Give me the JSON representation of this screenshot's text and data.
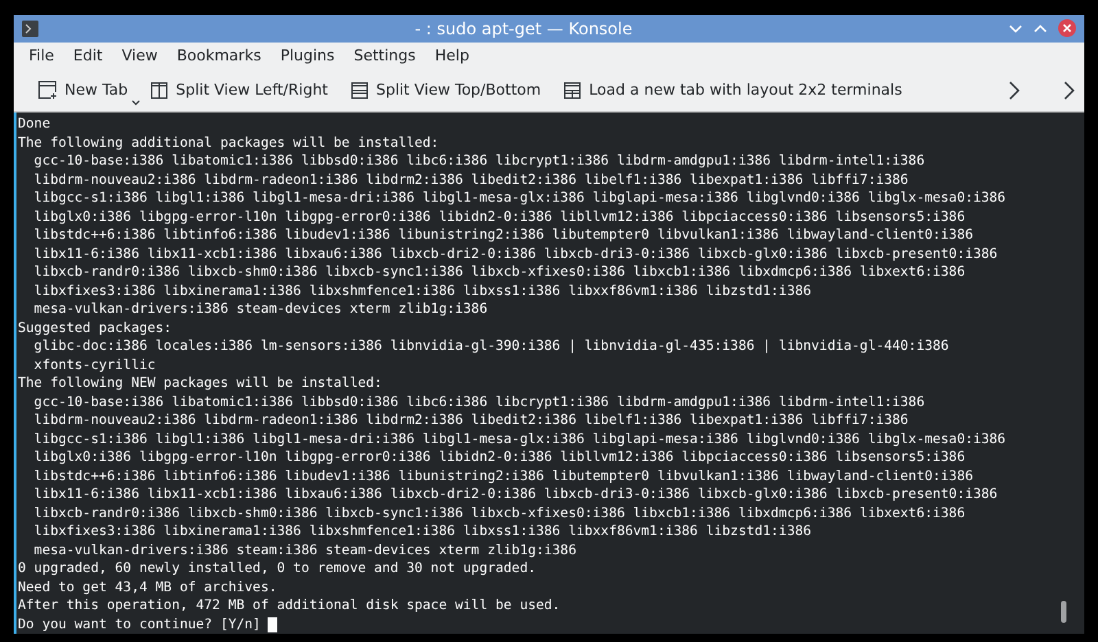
{
  "window": {
    "title": "- : sudo apt-get — Konsole"
  },
  "menu": [
    "File",
    "Edit",
    "View",
    "Bookmarks",
    "Plugins",
    "Settings",
    "Help"
  ],
  "toolbar": [
    {
      "kind": "new-tab",
      "label": "New Tab"
    },
    {
      "kind": "split-lr",
      "label": "Split View Left/Right"
    },
    {
      "kind": "split-tb",
      "label": "Split View Top/Bottom"
    },
    {
      "kind": "grid",
      "label": "Load a new tab with layout 2x2 terminals"
    }
  ],
  "terminal": {
    "lines": [
      {
        "indented": false,
        "text": "Done"
      },
      {
        "indented": false,
        "text": "The following additional packages will be installed:"
      },
      {
        "indented": true,
        "text": "gcc-10-base:i386 libatomic1:i386 libbsd0:i386 libc6:i386 libcrypt1:i386 libdrm-amdgpu1:i386 libdrm-intel1:i386"
      },
      {
        "indented": true,
        "text": "libdrm-nouveau2:i386 libdrm-radeon1:i386 libdrm2:i386 libedit2:i386 libelf1:i386 libexpat1:i386 libffi7:i386"
      },
      {
        "indented": true,
        "text": "libgcc-s1:i386 libgl1:i386 libgl1-mesa-dri:i386 libgl1-mesa-glx:i386 libglapi-mesa:i386 libglvnd0:i386 libglx-mesa0:i386"
      },
      {
        "indented": true,
        "text": "libglx0:i386 libgpg-error-l10n libgpg-error0:i386 libidn2-0:i386 libllvm12:i386 libpciaccess0:i386 libsensors5:i386"
      },
      {
        "indented": true,
        "text": "libstdc++6:i386 libtinfo6:i386 libudev1:i386 libunistring2:i386 libutempter0 libvulkan1:i386 libwayland-client0:i386"
      },
      {
        "indented": true,
        "text": "libx11-6:i386 libx11-xcb1:i386 libxau6:i386 libxcb-dri2-0:i386 libxcb-dri3-0:i386 libxcb-glx0:i386 libxcb-present0:i386"
      },
      {
        "indented": true,
        "text": "libxcb-randr0:i386 libxcb-shm0:i386 libxcb-sync1:i386 libxcb-xfixes0:i386 libxcb1:i386 libxdmcp6:i386 libxext6:i386"
      },
      {
        "indented": true,
        "text": "libxfixes3:i386 libxinerama1:i386 libxshmfence1:i386 libxss1:i386 libxxf86vm1:i386 libzstd1:i386"
      },
      {
        "indented": true,
        "text": "mesa-vulkan-drivers:i386 steam-devices xterm zlib1g:i386"
      },
      {
        "indented": false,
        "text": "Suggested packages:"
      },
      {
        "indented": true,
        "text": "glibc-doc:i386 locales:i386 lm-sensors:i386 libnvidia-gl-390:i386 | libnvidia-gl-435:i386 | libnvidia-gl-440:i386"
      },
      {
        "indented": true,
        "text": "xfonts-cyrillic"
      },
      {
        "indented": false,
        "text": "The following NEW packages will be installed:"
      },
      {
        "indented": true,
        "text": "gcc-10-base:i386 libatomic1:i386 libbsd0:i386 libc6:i386 libcrypt1:i386 libdrm-amdgpu1:i386 libdrm-intel1:i386"
      },
      {
        "indented": true,
        "text": "libdrm-nouveau2:i386 libdrm-radeon1:i386 libdrm2:i386 libedit2:i386 libelf1:i386 libexpat1:i386 libffi7:i386"
      },
      {
        "indented": true,
        "text": "libgcc-s1:i386 libgl1:i386 libgl1-mesa-dri:i386 libgl1-mesa-glx:i386 libglapi-mesa:i386 libglvnd0:i386 libglx-mesa0:i386"
      },
      {
        "indented": true,
        "text": "libglx0:i386 libgpg-error-l10n libgpg-error0:i386 libidn2-0:i386 libllvm12:i386 libpciaccess0:i386 libsensors5:i386"
      },
      {
        "indented": true,
        "text": "libstdc++6:i386 libtinfo6:i386 libudev1:i386 libunistring2:i386 libutempter0 libvulkan1:i386 libwayland-client0:i386"
      },
      {
        "indented": true,
        "text": "libx11-6:i386 libx11-xcb1:i386 libxau6:i386 libxcb-dri2-0:i386 libxcb-dri3-0:i386 libxcb-glx0:i386 libxcb-present0:i386"
      },
      {
        "indented": true,
        "text": "libxcb-randr0:i386 libxcb-shm0:i386 libxcb-sync1:i386 libxcb-xfixes0:i386 libxcb1:i386 libxdmcp6:i386 libxext6:i386"
      },
      {
        "indented": true,
        "text": "libxfixes3:i386 libxinerama1:i386 libxshmfence1:i386 libxss1:i386 libxxf86vm1:i386 libzstd1:i386"
      },
      {
        "indented": true,
        "text": "mesa-vulkan-drivers:i386 steam:i386 steam-devices xterm zlib1g:i386"
      },
      {
        "indented": false,
        "text": "0 upgraded, 60 newly installed, 0 to remove and 30 not upgraded."
      },
      {
        "indented": false,
        "text": "Need to get 43,4 MB of archives."
      },
      {
        "indented": false,
        "text": "After this operation, 472 MB of additional disk space will be used."
      }
    ],
    "prompt": "Do you want to continue? [Y/n]"
  }
}
